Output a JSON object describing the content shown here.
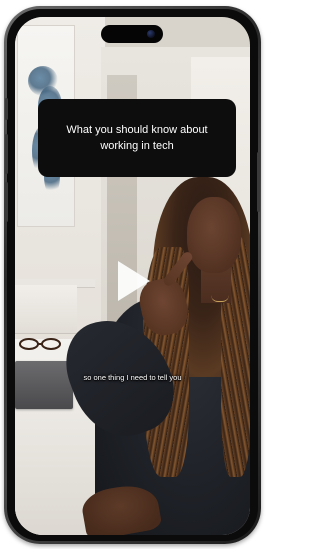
{
  "video": {
    "title_card": "What you should know about working in tech",
    "caption": "so one thing I need to tell you"
  },
  "icons": {
    "play": "play-icon",
    "camera": "front-camera-icon"
  },
  "colors": {
    "title_card_bg": "#0d0d0d",
    "title_card_text": "#ffffff",
    "phone_frame": "#2a2a2a",
    "caption_text": "#ffffff"
  }
}
